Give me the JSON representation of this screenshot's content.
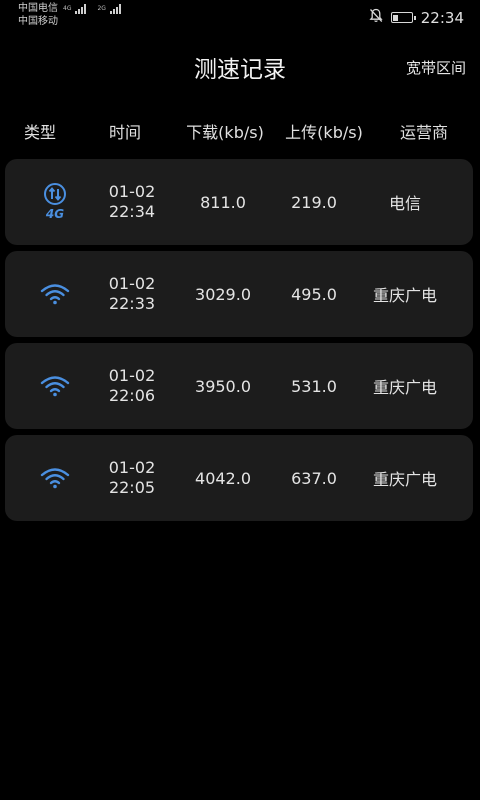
{
  "status_bar": {
    "carrier1": "中国电信",
    "carrier1_net": "4G",
    "carrier2": "中国移动",
    "carrier2_net": "2G",
    "time": "22:34",
    "battery_level": 0.3
  },
  "header": {
    "title": "测速记录",
    "right_link": "宽带区间"
  },
  "columns": [
    "类型",
    "时间",
    "下载(kb/s)",
    "上传(kb/s)",
    "运营商"
  ],
  "records": [
    {
      "type_icon": "4g-icon",
      "date": "01-02",
      "time": "22:34",
      "download": "811.0",
      "upload": "219.0",
      "operator": "电信"
    },
    {
      "type_icon": "wifi-icon",
      "date": "01-02",
      "time": "22:33",
      "download": "3029.0",
      "upload": "495.0",
      "operator": "重庆广电"
    },
    {
      "type_icon": "wifi-icon",
      "date": "01-02",
      "time": "22:06",
      "download": "3950.0",
      "upload": "531.0",
      "operator": "重庆广电"
    },
    {
      "type_icon": "wifi-icon",
      "date": "01-02",
      "time": "22:05",
      "download": "4042.0",
      "upload": "637.0",
      "operator": "重庆广电"
    }
  ],
  "colors": {
    "background": "#000000",
    "card": "#1c1c1c",
    "icon_blue": "#4a8fe0"
  }
}
